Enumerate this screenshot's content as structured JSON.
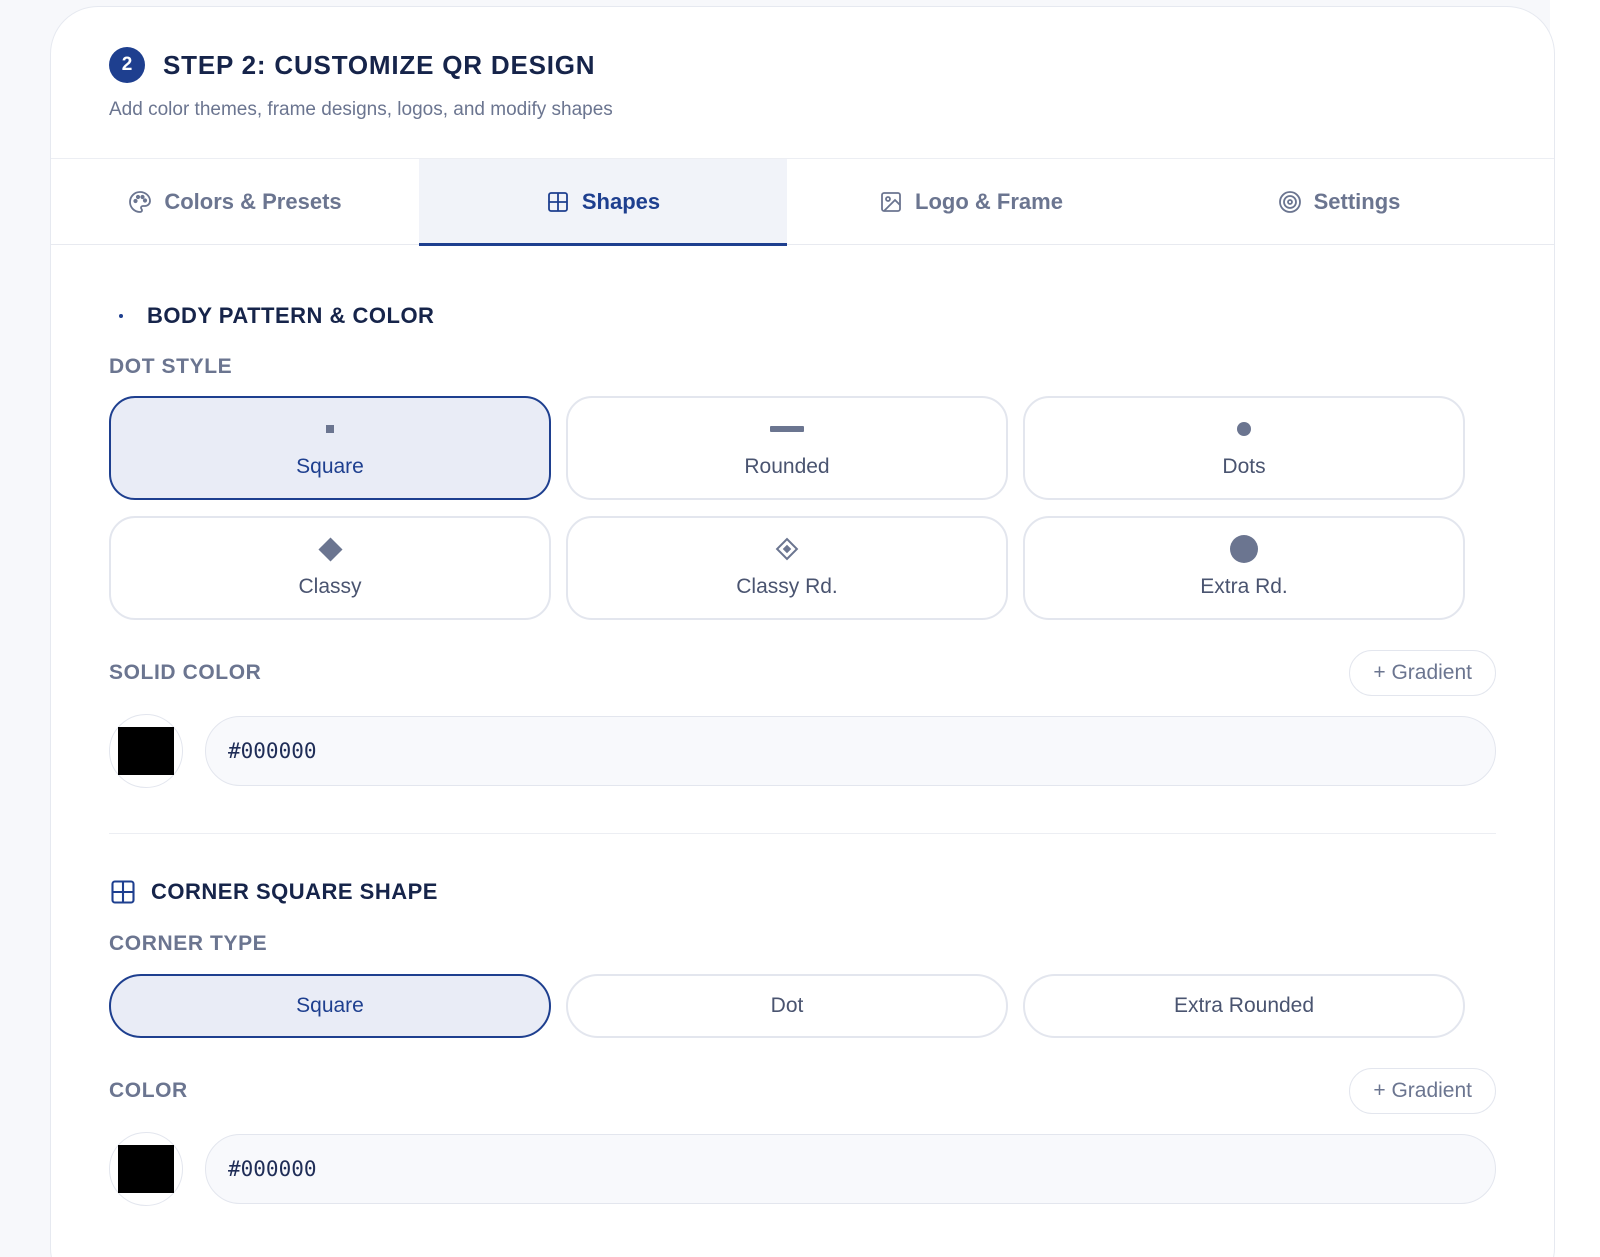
{
  "header": {
    "step_number": "2",
    "title": "STEP 2: CUSTOMIZE QR DESIGN",
    "subtitle": "Add color themes, frame designs, logos, and modify shapes"
  },
  "tabs": [
    {
      "label": "Colors & Presets",
      "icon": "palette-icon",
      "active": false
    },
    {
      "label": "Shapes",
      "icon": "grid-icon",
      "active": true
    },
    {
      "label": "Logo & Frame",
      "icon": "image-icon",
      "active": false
    },
    {
      "label": "Settings",
      "icon": "target-icon",
      "active": false
    }
  ],
  "body_section": {
    "title": "BODY PATTERN & COLOR",
    "dot_style_label": "DOT STYLE",
    "dot_styles": [
      {
        "label": "Square",
        "selected": true
      },
      {
        "label": "Rounded",
        "selected": false
      },
      {
        "label": "Dots",
        "selected": false
      },
      {
        "label": "Classy",
        "selected": false
      },
      {
        "label": "Classy Rd.",
        "selected": false
      },
      {
        "label": "Extra Rd.",
        "selected": false
      }
    ],
    "solid_color_label": "SOLID COLOR",
    "gradient_label": "+ Gradient",
    "color_value": "#000000"
  },
  "corner_section": {
    "title": "CORNER SQUARE SHAPE",
    "corner_type_label": "CORNER TYPE",
    "corner_types": [
      {
        "label": "Square",
        "selected": true
      },
      {
        "label": "Dot",
        "selected": false
      },
      {
        "label": "Extra Rounded",
        "selected": false
      }
    ],
    "color_label": "COLOR",
    "gradient_label": "+ Gradient",
    "color_value": "#000000"
  },
  "colors": {
    "accent": "#1e3f8f",
    "selected_bg": "#e9ecf6",
    "muted_text": "#6b7590",
    "swatch": "#000000"
  }
}
